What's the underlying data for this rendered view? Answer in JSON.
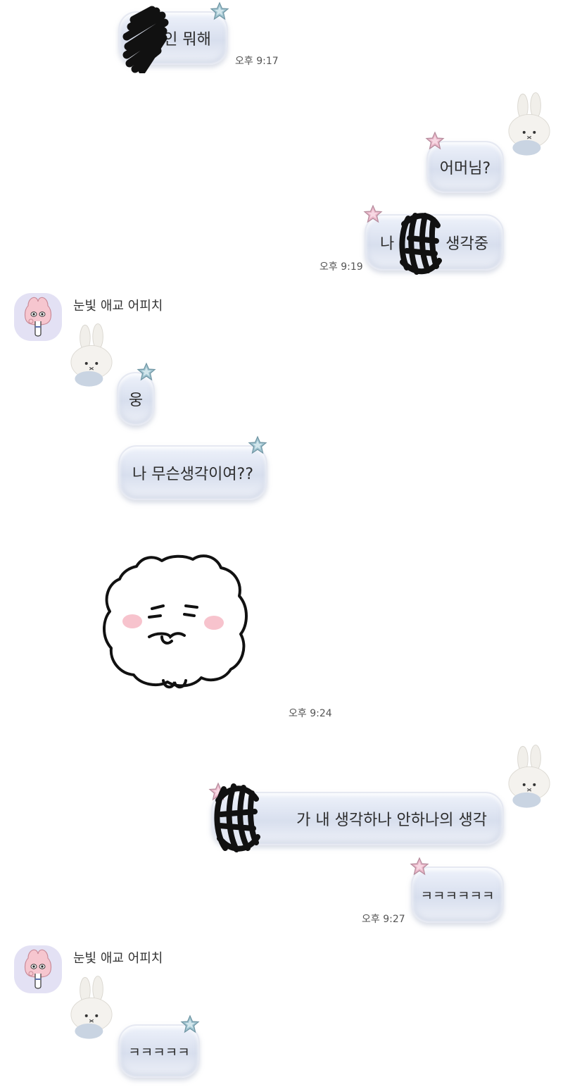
{
  "messages": {
    "m1_text": "인 뭐해",
    "m1_time": "오후 9:17",
    "m2_text": "어머님?",
    "m3_pre": "나",
    "m3_post": "생각중",
    "m3_time": "오후 9:19",
    "sender_name_1": "눈빛 애교 어피치",
    "m4_text": "웅",
    "m5_text": "나 무슨생각이여??",
    "sticker_time": "오후 9:24",
    "m6_text": "가 내 생각하나 안하나의 생각",
    "m7_text": "ㅋㅋㅋㅋㅋㅋ",
    "m7_time": "오후 9:27",
    "sender_name_2": "눈빛 애교 어피치",
    "m8_text": "ㅋㅋㅋㅋㅋ"
  },
  "colors": {
    "bubble_top": "#eef2fb",
    "bubble_mid": "#d8dfee",
    "star_pink": "#e9b7c9",
    "star_blue": "#9fc3cf",
    "avatar_bg": "#e3e1f4",
    "peach": "#f6c6cf"
  },
  "icons": {
    "star": "star-icon",
    "bunny": "bunny-sticker-icon",
    "avatar": "apeach-avatar-icon",
    "sticker": "fluffy-cloud-sticker"
  }
}
